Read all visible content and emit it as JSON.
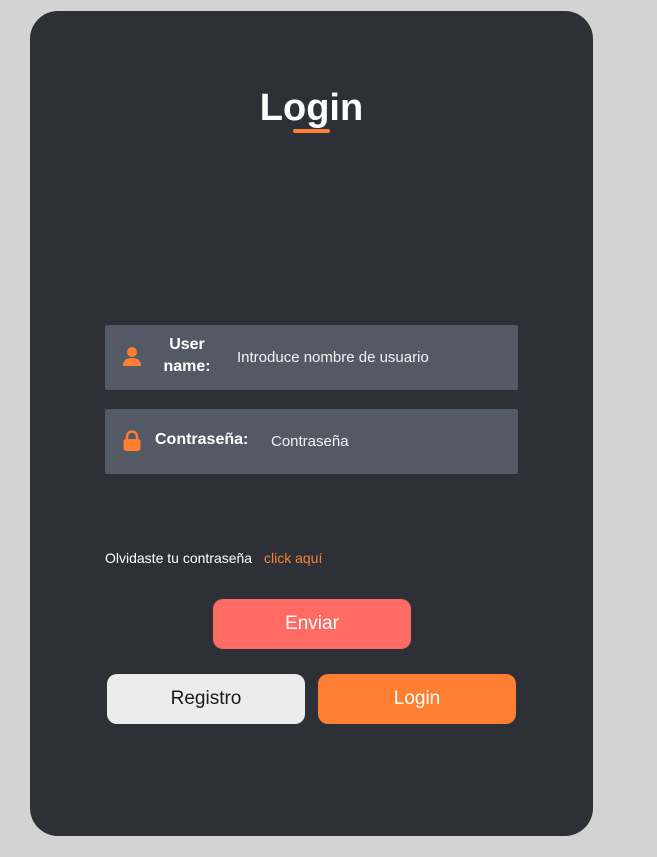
{
  "card": {
    "title": "Login"
  },
  "form": {
    "username": {
      "icon": "user-icon",
      "label": "User name:",
      "placeholder": "Introduce nombre de usuario",
      "value": ""
    },
    "password": {
      "icon": "lock-icon",
      "label": "Contraseña:",
      "placeholder": "Contraseña",
      "value": ""
    }
  },
  "forgot": {
    "text": "Olvidaste tu contraseña",
    "link": "click aquí"
  },
  "buttons": {
    "send": "Enviar",
    "register": "Registro",
    "login": "Login"
  },
  "colors": {
    "background": "#d3d3d3",
    "card": "#2e3038",
    "field": "#545966",
    "accent": "#ff7f32",
    "send": "#ff6b62",
    "register": "#ececec"
  }
}
